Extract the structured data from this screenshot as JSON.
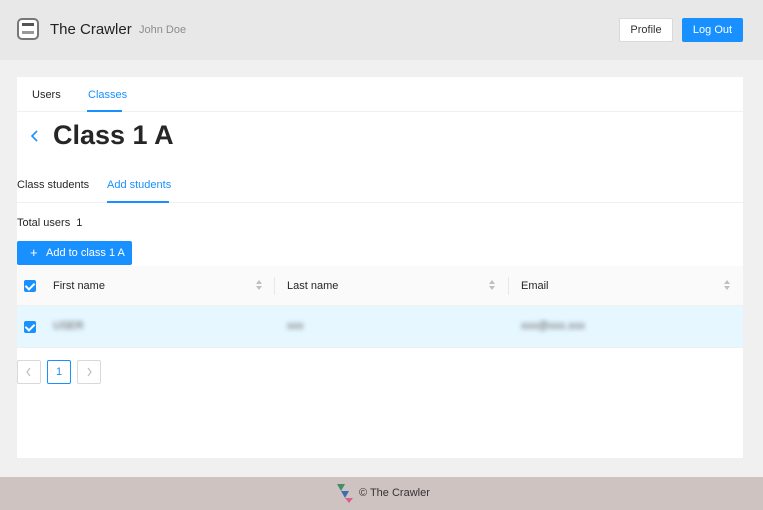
{
  "header": {
    "app_title": "The Crawler",
    "user_name": "John Doe",
    "profile_label": "Profile",
    "logout_label": "Log Out"
  },
  "top_tabs": [
    {
      "label": "Users",
      "active": false
    },
    {
      "label": "Classes",
      "active": true
    }
  ],
  "class_title": "Class 1 A",
  "sub_tabs": [
    {
      "label": "Class students",
      "active": false
    },
    {
      "label": "Add students",
      "active": true
    }
  ],
  "total": {
    "label": "Total users",
    "count": "1"
  },
  "add_button_label": "Add to class 1 A",
  "table": {
    "columns": [
      "First name",
      "Last name",
      "Email"
    ],
    "rows": [
      {
        "selected": true,
        "cells": [
          "USER",
          "xxx",
          "xxx@xxx.xxx"
        ]
      }
    ]
  },
  "pagination": {
    "current_page": "1",
    "prev_icon": "chevron-left-icon",
    "next_icon": "chevron-right-icon"
  },
  "footer": {
    "text": "© The Crawler"
  },
  "colors": {
    "accent": "#1890ff",
    "header_bg": "#e8e8e8",
    "footer_bg": "#cfc3c1",
    "selected_row_bg": "#e6f7ff"
  }
}
